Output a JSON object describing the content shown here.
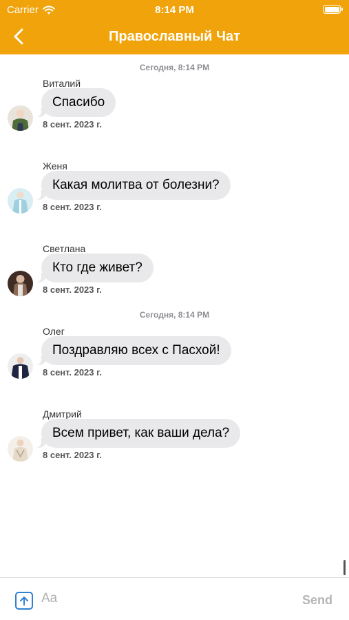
{
  "status_bar": {
    "carrier": "Carrier",
    "time": "8:14 PM"
  },
  "header": {
    "title": "Православный Чат",
    "back_icon": "chevron-left-icon"
  },
  "chat": {
    "date_separators": [
      "Сегодня, 8:14 PM",
      "Сегодня, 8:14 PM"
    ],
    "messages": [
      {
        "sender": "Виталий",
        "text": "Спасибо",
        "timestamp": "8 сент. 2023 г."
      },
      {
        "sender": "Женя",
        "text": "Какая молитва от болезни?",
        "timestamp": "8 сент. 2023 г."
      },
      {
        "sender": "Светлана",
        "text": "Кто где живет?",
        "timestamp": "8 сент. 2023 г."
      },
      {
        "sender": "Олег",
        "text": "Поздравляю всех с Пасхой!",
        "timestamp": "8 сент. 2023 г."
      },
      {
        "sender": "Дмитрий",
        "text": "Всем привет, как ваши дела?",
        "timestamp": "8 сент. 2023 г."
      }
    ]
  },
  "input": {
    "placeholder": "Aa",
    "send_label": "Send",
    "attach_icon": "upload-arrow-icon"
  },
  "colors": {
    "accent": "#f0a30a",
    "bubble": "#e9e9eb",
    "attach": "#2f7fd0"
  }
}
